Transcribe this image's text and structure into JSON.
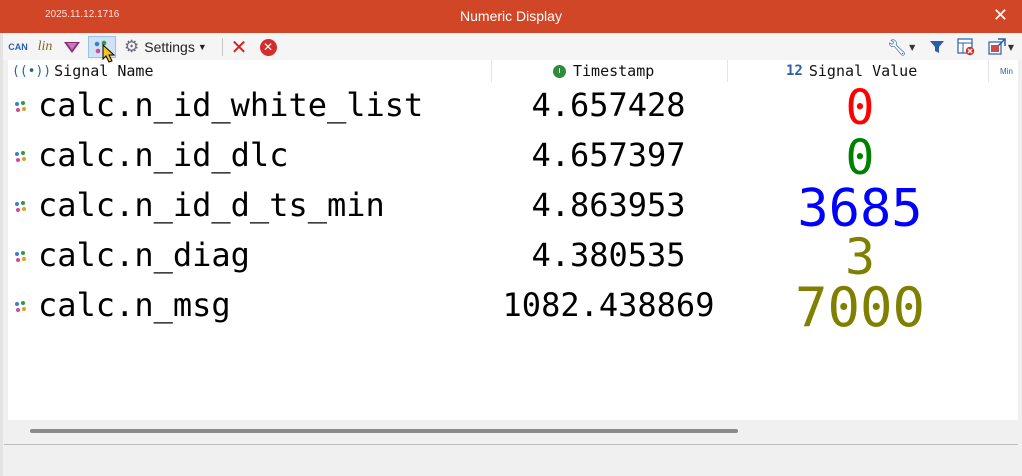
{
  "titlebar": {
    "stamp": "2025.11.12.1716",
    "title": "Numeric Display",
    "close_glyph": "✕"
  },
  "toolbar": {
    "can_label": "CAN",
    "lin_label": "lin",
    "settings_label": "Settings",
    "icons": [
      "can-filter-icon",
      "lin-filter-icon",
      "flexray-filter-icon",
      "signal-filter-icon",
      "gear-icon",
      "delete-icon",
      "delete-all-icon",
      "wrench-icon",
      "funnel-icon",
      "grid-remove-icon",
      "popout-icon"
    ]
  },
  "header": {
    "signal_name": "Signal Name",
    "timestamp": "Timestamp",
    "signal_value_icon": "12",
    "signal_value": "Signal Value",
    "min": "Min"
  },
  "rows": [
    {
      "name": "calc.n_id_white_list",
      "timestamp": "4.657428",
      "value": "0",
      "value_color": "#ff0000"
    },
    {
      "name": "calc.n_id_dlc",
      "timestamp": "4.657397",
      "value": "0",
      "value_color": "#008000"
    },
    {
      "name": "calc.n_id_d_ts_min",
      "timestamp": "4.863953",
      "value": "3685",
      "value_color": "#0000ff"
    },
    {
      "name": "calc.n_diag",
      "timestamp": "4.380535",
      "value": "3",
      "value_color": "#808000"
    },
    {
      "name": "calc.n_msg",
      "timestamp": "1082.438869",
      "value": "7000",
      "value_color": "#808000"
    }
  ]
}
